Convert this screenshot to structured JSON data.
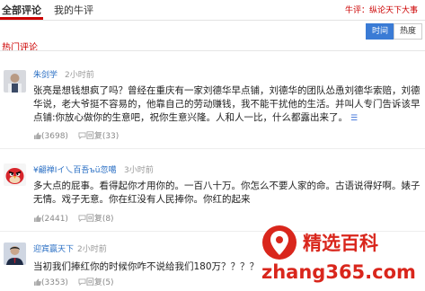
{
  "tabs": [
    {
      "label": "全部评论",
      "active": true
    },
    {
      "label": "我的牛评",
      "active": false
    }
  ],
  "header_link": "牛评：纵论天下大事",
  "sort": {
    "options": [
      "时间",
      "热度"
    ],
    "selected": "时间"
  },
  "section_title": "热门评论",
  "comments": [
    {
      "user": "朱剑学",
      "time": "2小时前",
      "text": "张亮是想钱想疯了吗？曾经在重庆有一家刘德华早点铺，刘德华的团队怂恿刘德华索赔，刘德华说，老大爷挺不容易的，他靠自己的劳动赚钱，我不能干扰他的生活。并叫人专门告诉该早点铺:你放心做你的生意吧，祝你生意兴隆。人和人一比，什么都露出来了。",
      "likes": "(3698)",
      "replies": "回复(33)"
    },
    {
      "user": "¥翩禅Ⅰイ乀百吾ъü忽噶",
      "time": "3小时前",
      "text": "多大点的屁事。看得起你才用你的。一百八十万。你怎么不要人家的命。古语说得好啊。婊子无情。戏子无意。你在红没有人民捧你。你红的起来",
      "likes": "(2441)",
      "replies": "回复(8)"
    },
    {
      "user": "迎宾赢天下",
      "time": "2小时前",
      "text": "当初我们捧红你的时候你咋不说给我们180万？？？？",
      "likes": "(3353)",
      "replies": "回复(5)"
    }
  ],
  "watermark": {
    "brand": "精选百科",
    "site": "zhang365.com"
  },
  "colors": {
    "accent_red": "#cc0000",
    "link_blue": "#2a6fc4",
    "toggle_blue": "#3a7bd5"
  }
}
